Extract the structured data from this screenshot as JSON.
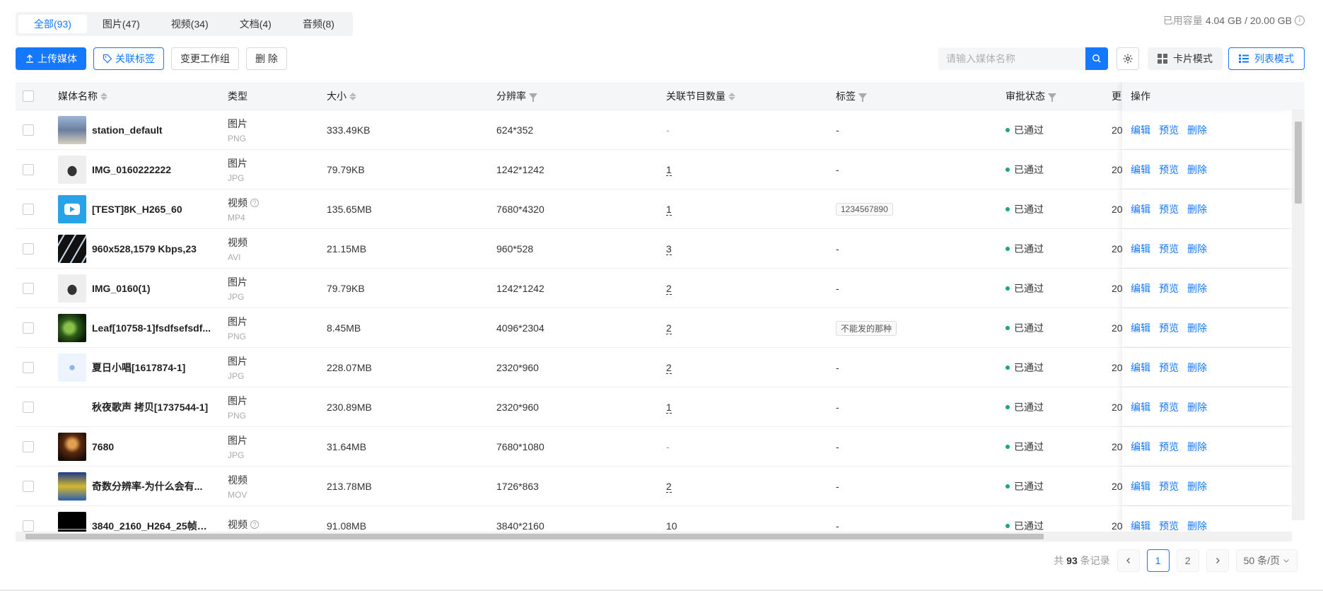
{
  "tabs": [
    {
      "label": "全部(93)"
    },
    {
      "label": "图片(47)"
    },
    {
      "label": "视频(34)"
    },
    {
      "label": "文档(4)"
    },
    {
      "label": "音频(8)"
    }
  ],
  "capacity": {
    "label": "已用容量",
    "value": "4.04 GB / 20.00 GB"
  },
  "toolbar": {
    "upload": "上传媒体",
    "tag": "关联标签",
    "change_group": "变更工作组",
    "delete": "删 除"
  },
  "search": {
    "placeholder": "请输入媒体名称"
  },
  "view_modes": {
    "card": "卡片模式",
    "list": "列表模式"
  },
  "columns": {
    "name": "媒体名称",
    "type": "类型",
    "size": "大小",
    "resolution": "分辨率",
    "related_count": "关联节目数量",
    "tags": "标签",
    "status": "审批状态",
    "updated": "更",
    "actions": "操作"
  },
  "actions": {
    "edit": "编辑",
    "preview": "预览",
    "delete": "删除"
  },
  "rows": [
    {
      "name": "station_default",
      "type": "图片",
      "ext": "PNG",
      "size": "333.49KB",
      "resolution": "624*352",
      "count": "-",
      "tag": "-",
      "status": "已通过",
      "updated": "20"
    },
    {
      "name": "IMG_0160222222",
      "type": "图片",
      "ext": "JPG",
      "size": "79.79KB",
      "resolution": "1242*1242",
      "count": "1",
      "tag": "-",
      "status": "已通过",
      "updated": "20"
    },
    {
      "name": "[TEST]8K_H265_60",
      "type": "视频",
      "ext": "MP4",
      "size": "135.65MB",
      "resolution": "7680*4320",
      "count": "1",
      "tag": "1234567890",
      "status": "已通过",
      "updated": "20"
    },
    {
      "name": "960x528,1579 Kbps,23",
      "type": "视频",
      "ext": "AVI",
      "size": "21.15MB",
      "resolution": "960*528",
      "count": "3",
      "tag": "-",
      "status": "已通过",
      "updated": "20"
    },
    {
      "name": "IMG_0160(1)",
      "type": "图片",
      "ext": "JPG",
      "size": "79.79KB",
      "resolution": "1242*1242",
      "count": "2",
      "tag": "-",
      "status": "已通过",
      "updated": "20"
    },
    {
      "name": "Leaf[10758-1]fsdfsefsdf...",
      "type": "图片",
      "ext": "PNG",
      "size": "8.45MB",
      "resolution": "4096*2304",
      "count": "2",
      "tag": "不能发的那种",
      "status": "已通过",
      "updated": "20"
    },
    {
      "name": "夏日小唱[1617874-1]",
      "type": "图片",
      "ext": "JPG",
      "size": "228.07MB",
      "resolution": "2320*960",
      "count": "2",
      "tag": "-",
      "status": "已通过",
      "updated": "20"
    },
    {
      "name": "秋夜歌声 拷贝[1737544-1]",
      "type": "图片",
      "ext": "PNG",
      "size": "230.89MB",
      "resolution": "2320*960",
      "count": "1",
      "tag": "-",
      "status": "已通过",
      "updated": "20"
    },
    {
      "name": "7680",
      "type": "图片",
      "ext": "JPG",
      "size": "31.64MB",
      "resolution": "7680*1080",
      "count": "-",
      "tag": "-",
      "status": "已通过",
      "updated": "20"
    },
    {
      "name": "奇数分辨率-为什么会有...",
      "type": "视频",
      "ext": "MOV",
      "size": "213.78MB",
      "resolution": "1726*863",
      "count": "2",
      "tag": "-",
      "status": "已通过",
      "updated": "20"
    },
    {
      "name": "3840_2160_H264_25帧_1...",
      "type": "视频",
      "ext": "",
      "size": "91.08MB",
      "resolution": "3840*2160",
      "count": "10",
      "tag": "-",
      "status": "已通过",
      "updated": "20"
    }
  ],
  "pagination": {
    "total_prefix": "共",
    "total": "93",
    "total_suffix": "条记录",
    "page1": "1",
    "page2": "2",
    "page_size": "50 条/页"
  }
}
